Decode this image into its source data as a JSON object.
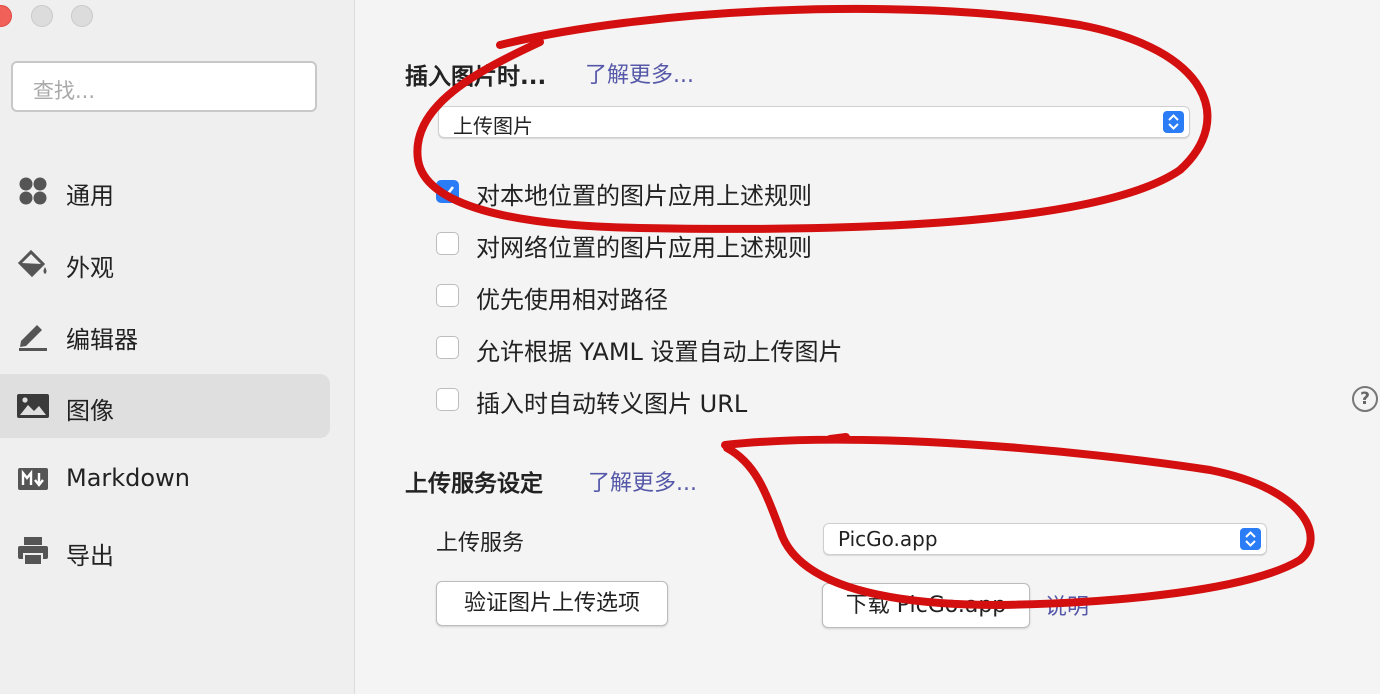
{
  "sidebar": {
    "search_placeholder": "查找...",
    "items": [
      {
        "label": "通用",
        "icon": "grid-icon"
      },
      {
        "label": "外观",
        "icon": "paint-bucket-icon"
      },
      {
        "label": "编辑器",
        "icon": "pencil-icon"
      },
      {
        "label": "图像",
        "icon": "image-icon",
        "active": true
      },
      {
        "label": "Markdown",
        "icon": "markdown-icon"
      },
      {
        "label": "导出",
        "icon": "printer-icon"
      }
    ]
  },
  "insert_section": {
    "title": "插入图片时...",
    "learn_more": "了解更多...",
    "action_value": "上传图片",
    "options": [
      {
        "label": "对本地位置的图片应用上述规则",
        "checked": true
      },
      {
        "label": "对网络位置的图片应用上述规则",
        "checked": false
      },
      {
        "label": "优先使用相对路径",
        "checked": false
      },
      {
        "label": "允许根据 YAML 设置自动上传图片",
        "checked": false
      },
      {
        "label": "插入时自动转义图片 URL",
        "checked": false
      }
    ],
    "help": "?"
  },
  "upload_section": {
    "title": "上传服务设定",
    "learn_more": "了解更多...",
    "service_label": "上传服务",
    "service_value": "PicGo.app",
    "verify_button": "验证图片上传选项",
    "download_button": "下载 PicGo.app",
    "explain_link": "说明"
  },
  "colors": {
    "accent": "#2b7df7",
    "link": "#5558a8",
    "annotation": "#d40f0f"
  }
}
